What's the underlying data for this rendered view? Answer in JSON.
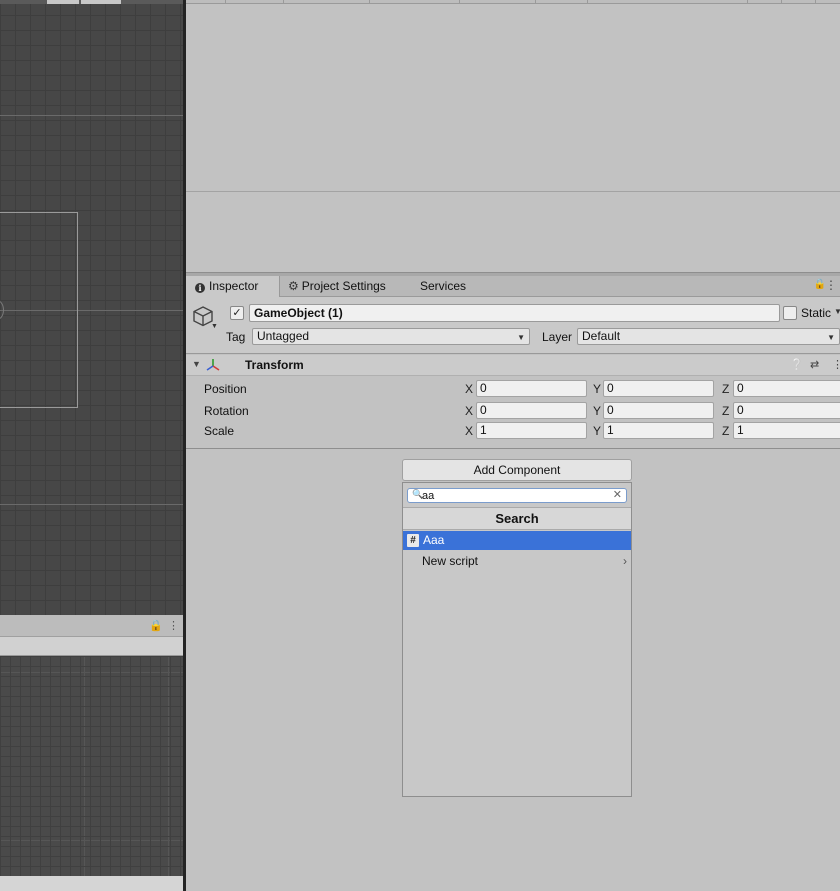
{
  "inspector": {
    "tabs": [
      {
        "label": "Inspector",
        "icon": "info-icon"
      },
      {
        "label": "Project Settings",
        "icon": "gear-icon"
      },
      {
        "label": "Services",
        "icon": ""
      }
    ],
    "object_name": "GameObject (1)",
    "static_label": "Static",
    "tag_label": "Tag",
    "tag_value": "Untagged",
    "layer_label": "Layer",
    "layer_value": "Default",
    "active": true
  },
  "transform": {
    "title": "Transform",
    "rows": [
      {
        "label": "Position",
        "x": "0",
        "y": "0",
        "z": "0"
      },
      {
        "label": "Rotation",
        "x": "0",
        "y": "0",
        "z": "0"
      },
      {
        "label": "Scale",
        "x": "1",
        "y": "1",
        "z": "1"
      }
    ],
    "axes": [
      "X",
      "Y",
      "Z"
    ]
  },
  "add_component": {
    "button_label": "Add Component",
    "search_value": "aa",
    "section_title": "Search",
    "results": [
      {
        "label": "Aaa",
        "selected": true
      },
      {
        "label": "New script",
        "has_submenu": true
      }
    ]
  },
  "colors": {
    "selection": "#3a72d8",
    "scene_bg": "#474747",
    "panel_bg": "#c2c2c2"
  }
}
